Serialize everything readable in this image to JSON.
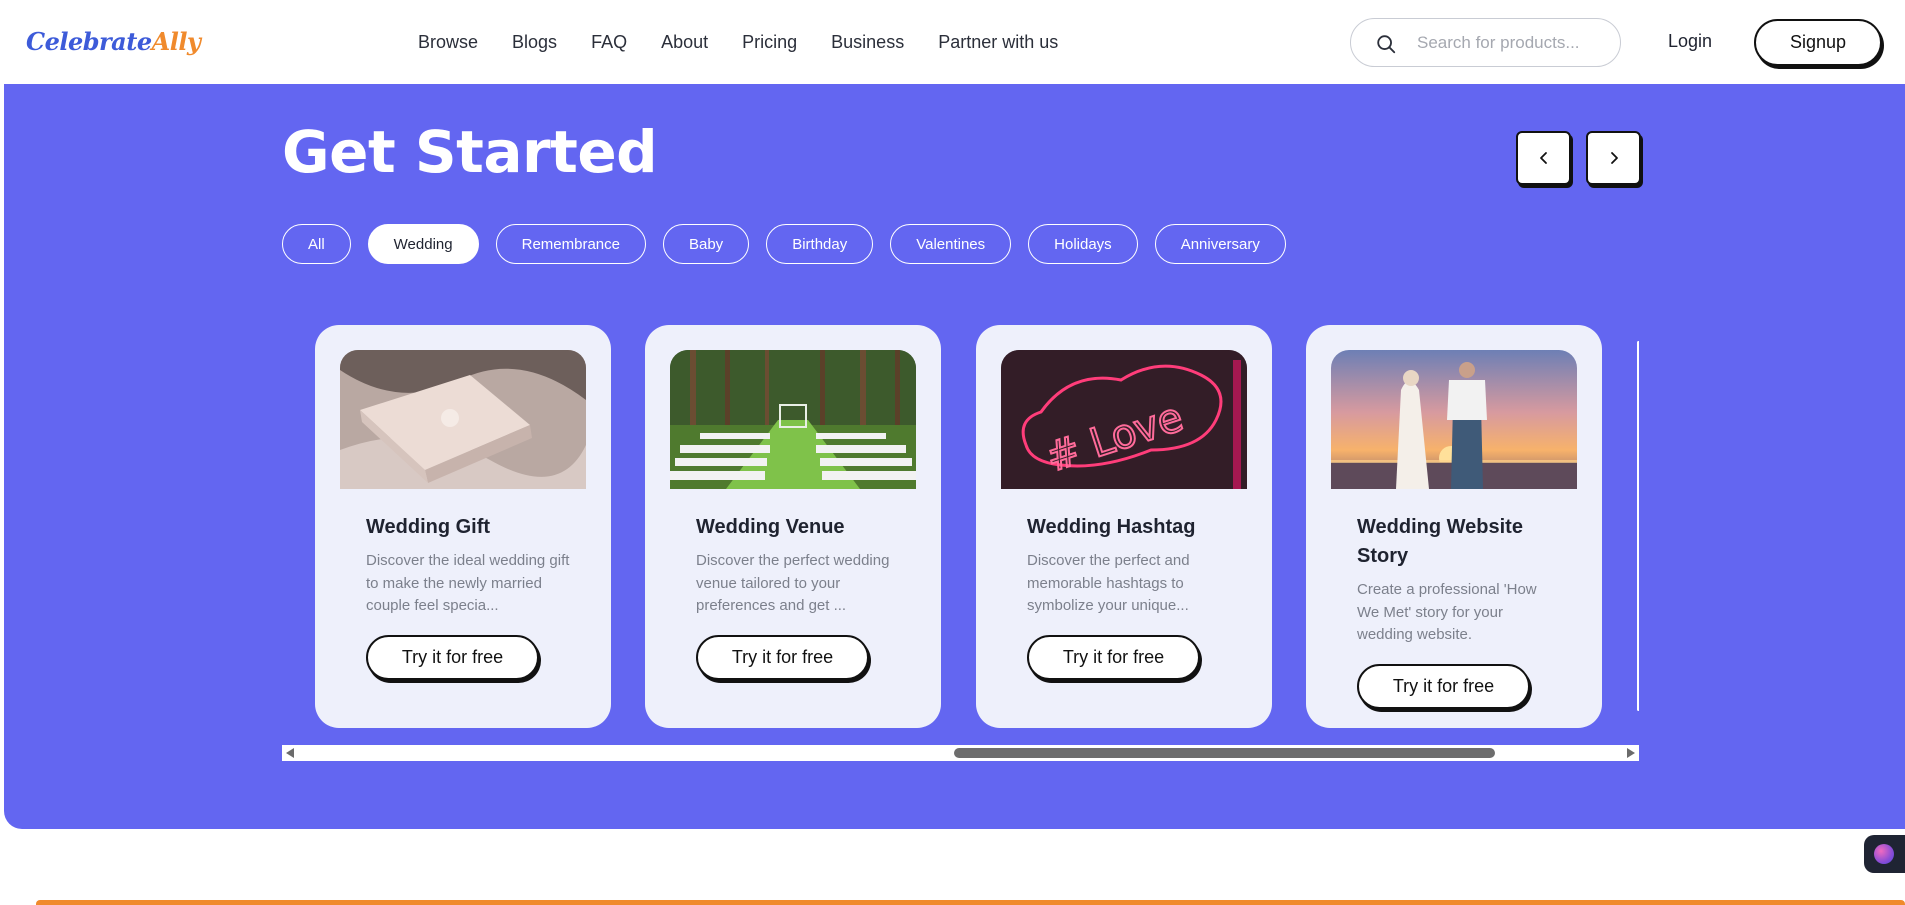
{
  "brand": {
    "part1": "Celebrate",
    "part2": "Ally",
    "color1": "#3d5bd9",
    "color2": "#f08a2c"
  },
  "nav": [
    {
      "label": "Browse"
    },
    {
      "label": "Blogs"
    },
    {
      "label": "FAQ"
    },
    {
      "label": "About"
    },
    {
      "label": "Pricing"
    },
    {
      "label": "Business"
    },
    {
      "label": "Partner with us"
    }
  ],
  "search": {
    "placeholder": "Search for products...",
    "value": "",
    "icon": "search-icon"
  },
  "auth": {
    "login": "Login",
    "signup": "Signup"
  },
  "hero": {
    "title": "Get Started",
    "accent": "#6366f1",
    "prev_icon": "chevron-left-icon",
    "next_icon": "chevron-right-icon"
  },
  "chips": [
    {
      "label": "All",
      "active": false
    },
    {
      "label": "Wedding",
      "active": true
    },
    {
      "label": "Remembrance",
      "active": false
    },
    {
      "label": "Baby",
      "active": false
    },
    {
      "label": "Birthday",
      "active": false
    },
    {
      "label": "Valentines",
      "active": false
    },
    {
      "label": "Holidays",
      "active": false
    },
    {
      "label": "Anniversary",
      "active": false
    }
  ],
  "cards": [
    {
      "title": "Wedding Gift",
      "description": "Discover the ideal wedding gift to make the newly married couple feel specia...",
      "cta": "Try it for free",
      "image": "gift-box-on-satin"
    },
    {
      "title": "Wedding Venue",
      "description": "Discover the perfect wedding venue tailored to your preferences and get ...",
      "cta": "Try it for free",
      "image": "forest-ceremony-aisle"
    },
    {
      "title": "Wedding Hashtag",
      "description": "Discover the perfect and memorable hashtags to symbolize your unique...",
      "cta": "Try it for free",
      "image": "neon-love-sign"
    },
    {
      "title": "Wedding Website Story",
      "description": "Create a professional 'How We Met' story for your wedding website.",
      "cta": "Try it for free",
      "image": "couple-at-sunset-beach"
    }
  ],
  "widget_icon": "assistant-orb-icon"
}
